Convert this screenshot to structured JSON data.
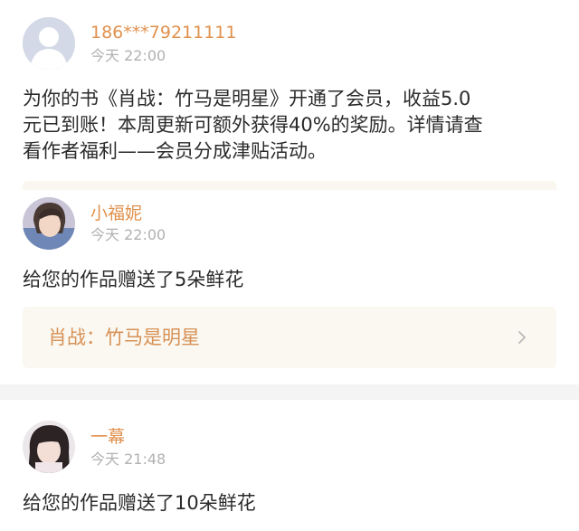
{
  "notice": {
    "sender": "186***79211111",
    "time": "今天 22:00",
    "lines": [
      "为你的书《肖战：竹马是明星》开通了会员，收益5.0",
      "元已到账！本周更新可额外获得40%的奖励。详情请查",
      "看作者福利——会员分成津贴活动。"
    ]
  },
  "gifts": [
    {
      "sender": "小福妮",
      "time": "今天 22:00",
      "message": "给您的作品赠送了5朵鲜花",
      "book_title": "肖战：竹马是明星",
      "avatar": "user-photo-icon"
    },
    {
      "sender": "一幕",
      "time": "今天 21:48",
      "message": "给您的作品赠送了10朵鲜花",
      "avatar": "user-photo-icon"
    }
  ],
  "icons": {
    "default_avatar": "default-user-silhouette-icon",
    "chevron": "chevron-right-icon"
  },
  "colors": {
    "name": "#e0914e",
    "book_link": "#d79156",
    "timestamp": "#b1b1b1",
    "card_bg": "#faf8f1"
  }
}
